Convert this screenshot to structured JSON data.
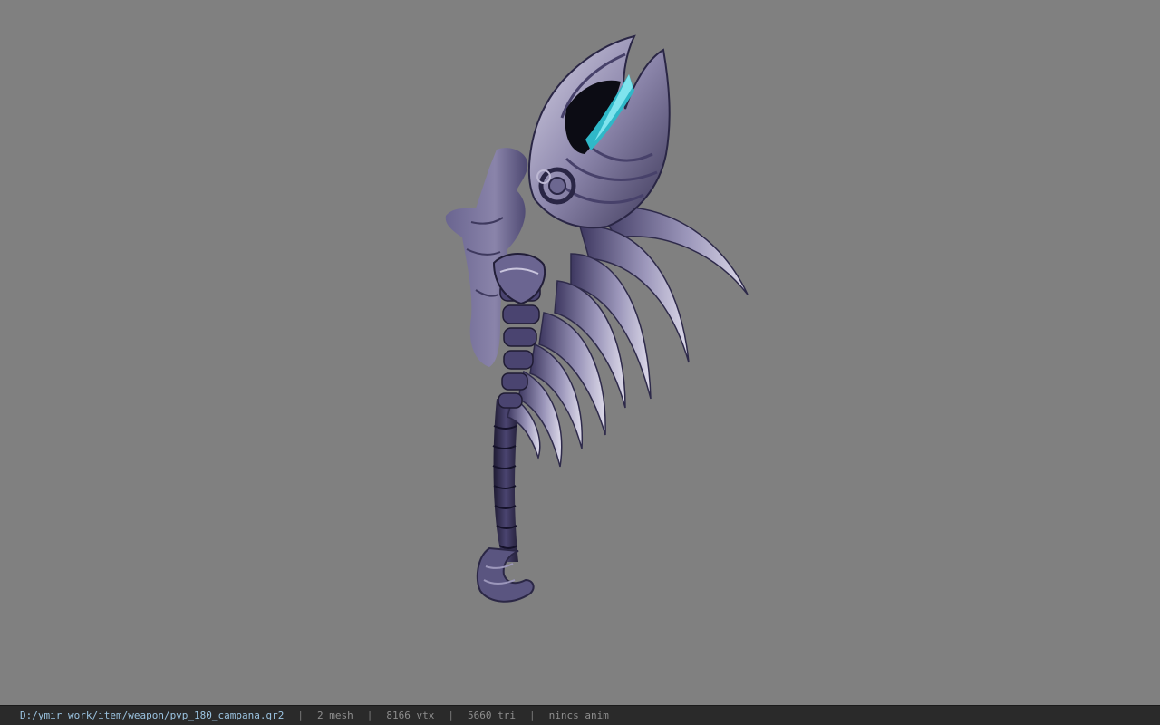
{
  "viewer": {
    "background_color": "#808080",
    "model_icon": "3d-weapon-model"
  },
  "statusbar": {
    "file_path": "D:/ymir work/item/weapon/pvp_180_campana.gr2",
    "mesh": "2 mesh",
    "vertices": "8166 vtx",
    "triangles": "5660 tri",
    "anim": "nincs anim",
    "separator": "|",
    "path_color": "#9bc3e0",
    "text_color": "#8e8e8e"
  }
}
